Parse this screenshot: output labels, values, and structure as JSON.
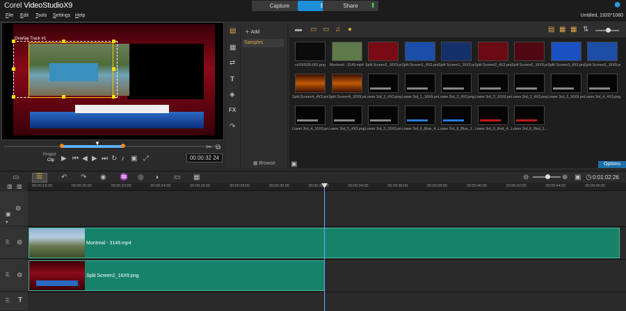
{
  "app": {
    "brand": "Corel",
    "name": "VideoStudioX9"
  },
  "tabs": [
    "Capture",
    "Edit",
    "Share"
  ],
  "menu": [
    "File",
    "Edit",
    "Tools",
    "Settings",
    "Help"
  ],
  "status": "Untitled, 1920*1080",
  "preview": {
    "overlay_label": "Overlay Track #1",
    "project_label": "Project",
    "clip_label": "Clip",
    "timecode": "00:00:32 24"
  },
  "library": {
    "add": "Add",
    "folders": [
      "Samples"
    ],
    "browse": "Browse",
    "options": "Options",
    "items": [
      "vs160526-001.png",
      "Montreal - 3149.mp4",
      "Split Screen2_16X9.png",
      "Split Screen1_4X3.png",
      "Split Screen1_16X9.png",
      "Split Screen2_4X3.png",
      "Split Screen2_16X9.png",
      "Split Screen3_4X3.png",
      "Split Screen3_16X9.png",
      "Split Screen4_4X3.png",
      "Split Screen4_16X9.png",
      "Lower 3rd_1_4X3.png",
      "Lower 3rd_1_16X9.png",
      "Lower 3rd_2_4X3.png",
      "Lower 3rd_2_16X9.png",
      "Lower 3rd_3_4X3.png",
      "Lower 3rd_3_16X9.png",
      "Lower 3rd_4_4X3.png",
      "Lower 3rd_4_16X9.png",
      "Lower 3rd_5_4X3.png",
      "Lower 3rd_5_16X9.png",
      "Lower 3rd_6_Blue_4...",
      "Lower 3rd_6_Blue_1...",
      "Lower 3rd_6_Red_4...",
      "Lower 3rd_6_Red_1..."
    ]
  },
  "timeline": {
    "timecode": "0:01:02:26",
    "ruler": [
      "00:00:18:00",
      "00:00:20:00",
      "00:00:22:00",
      "00:00:24:00",
      "00:00:26:00",
      "00:00:28:00",
      "00:00:30:00",
      "00:00:32:00",
      "00:00:34:00",
      "00:00:36:00",
      "00:00:38:00",
      "00:00:40:00",
      "00:00:42:00",
      "00:00:44:00",
      "00:00:46:00"
    ],
    "clips": {
      "video": "Montreal - 3149.mp4",
      "overlay": "Split Screen2_16X9.png"
    }
  }
}
